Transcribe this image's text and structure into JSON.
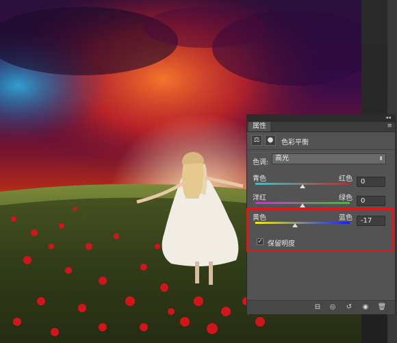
{
  "panel": {
    "tab_label": "属性",
    "adjustment_title": "色彩平衡",
    "tone_label": "色调:",
    "tone_value": "高光",
    "sliders": [
      {
        "left": "青色",
        "right": "红色",
        "value": "0",
        "position": 0.5
      },
      {
        "left": "洋红",
        "right": "绿色",
        "value": "0",
        "position": 0.5
      },
      {
        "left": "黄色",
        "right": "蓝色",
        "value": "-17",
        "position": 0.42
      }
    ],
    "preserve_luminosity_label": "保留明度",
    "preserve_luminosity_checked": true
  },
  "colors": {
    "highlight_border": "#e0151a",
    "panel_bg": "#535353"
  },
  "icons": [
    "balance-icon",
    "mask-icon",
    "panel-menu-icon",
    "clip-to-layer-icon",
    "view-previous-icon",
    "reset-icon",
    "visibility-eye-icon",
    "trash-icon"
  ]
}
